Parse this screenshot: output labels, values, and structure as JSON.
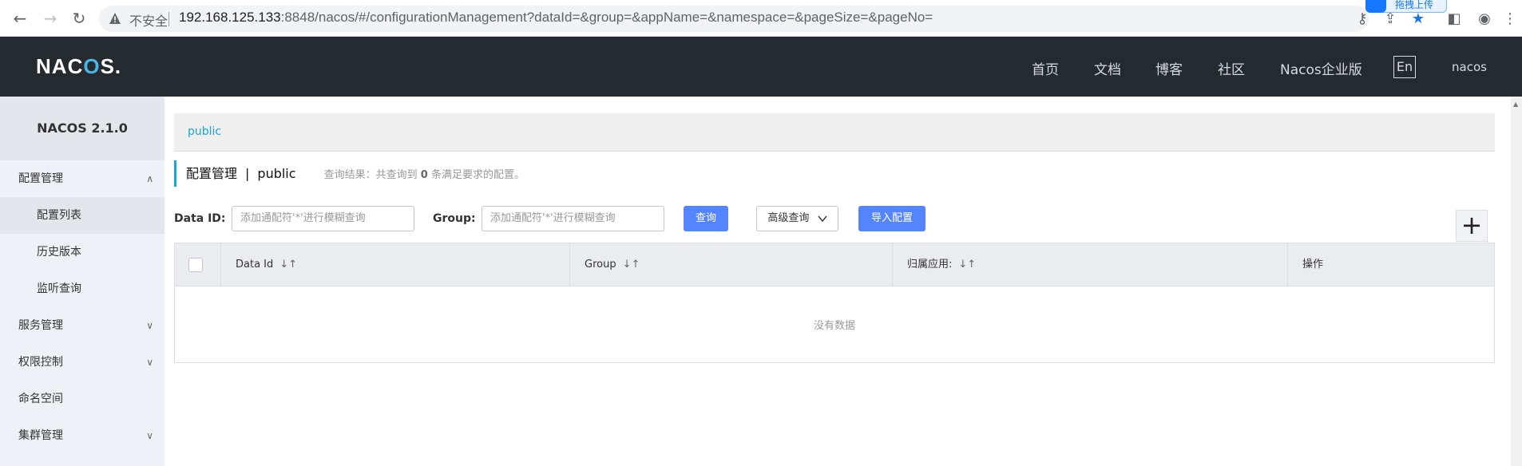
{
  "browser": {
    "insecure_label": "不安全",
    "url_host": "192.168.125.133",
    "url_rest": ":8848/nacos/#/configurationManagement?dataId=&group=&appName=&namespace=&pageSize=&pageNo=",
    "extension_popup": "拖拽上传"
  },
  "header": {
    "logo_prefix": "NA",
    "logo_mid": "C",
    "logo_ring": "O",
    "logo_suffix": "S.",
    "nav": [
      "首页",
      "文档",
      "博客",
      "社区",
      "Nacos企业版"
    ],
    "lang": "En",
    "user": "nacos"
  },
  "sidebar": {
    "version": "NACOS 2.1.0",
    "items": [
      {
        "label": "配置管理",
        "arrow": "∧"
      },
      {
        "label": "配置列表"
      },
      {
        "label": "历史版本"
      },
      {
        "label": "监听查询"
      },
      {
        "label": "服务管理",
        "arrow": "∨"
      },
      {
        "label": "权限控制",
        "arrow": "∨"
      },
      {
        "label": "命名空间"
      },
      {
        "label": "集群管理",
        "arrow": "∨"
      }
    ]
  },
  "main": {
    "namespace_tab": "public",
    "title": "配置管理",
    "title_sep": "|",
    "title_ns": "public",
    "query_result_prefix": "查询结果：共查询到",
    "query_result_count": "0",
    "query_result_suffix": "条满足要求的配置。",
    "data_id_label": "Data ID:",
    "data_id_placeholder": "添加通配符'*'进行模糊查询",
    "group_label": "Group:",
    "group_placeholder": "添加通配符'*'进行模糊查询",
    "search_button": "查询",
    "advanced_button": "高级查询",
    "import_button": "导入配置",
    "add_button": "+"
  },
  "table": {
    "columns": [
      "Data Id",
      "Group",
      "归属应用:",
      "操作"
    ],
    "empty_text": "没有数据"
  },
  "colors": {
    "header_bg": "#252a2f",
    "accent": "#1ba5d8",
    "primary_button": "#5584ff"
  }
}
